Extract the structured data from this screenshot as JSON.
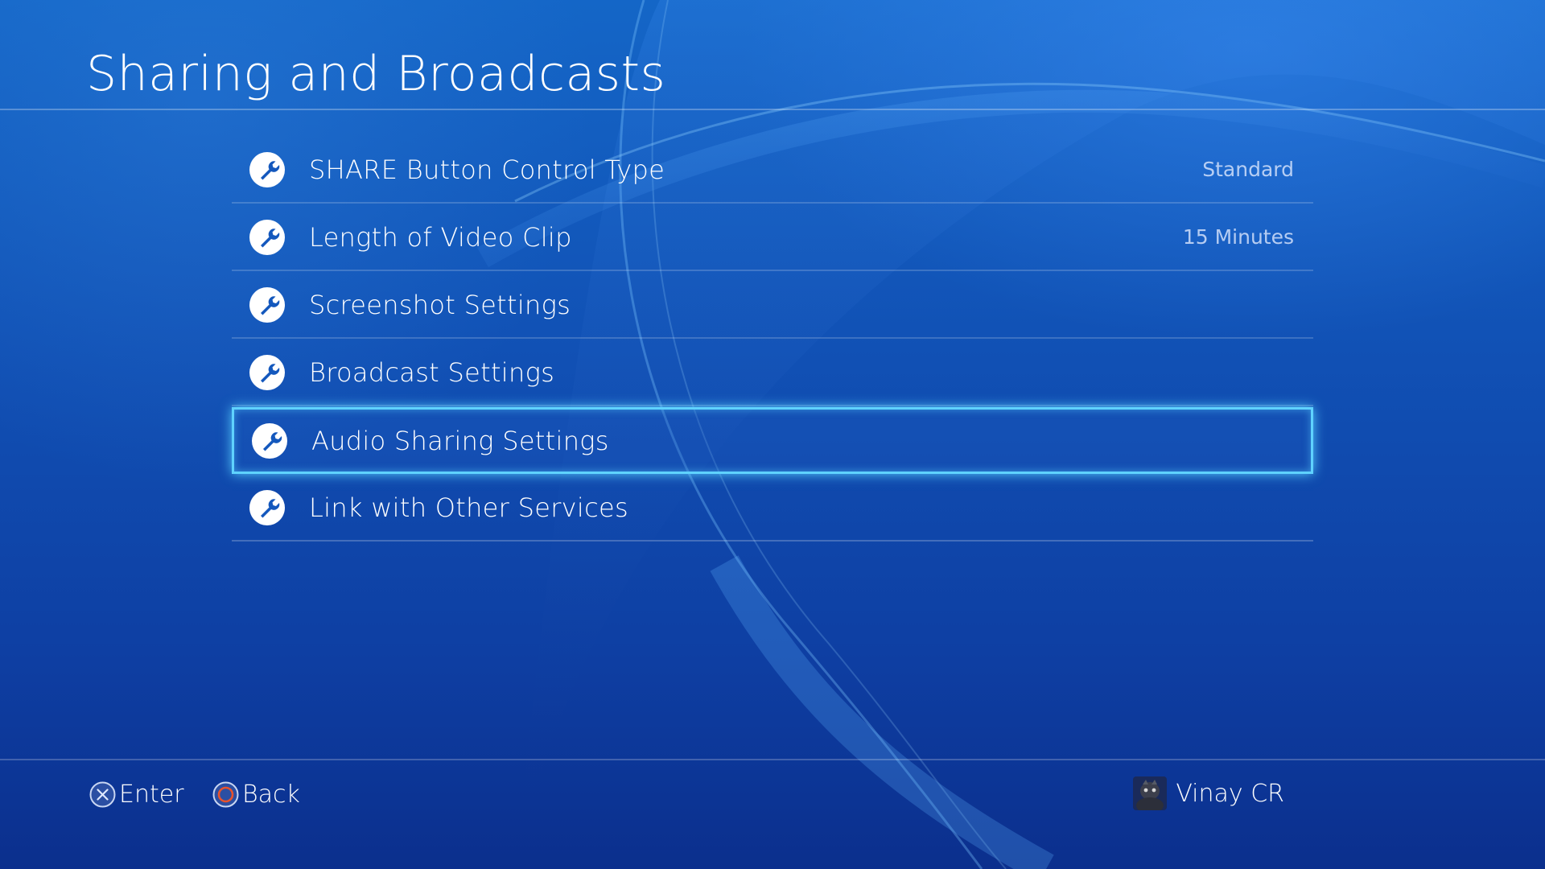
{
  "screen": {
    "title": "Sharing and Broadcasts"
  },
  "menu": {
    "items": [
      {
        "label": "SHARE Button Control Type",
        "value": "Standard",
        "icon": "wrench-icon",
        "selected": false
      },
      {
        "label": "Length of Video Clip",
        "value": "15 Minutes",
        "icon": "wrench-icon",
        "selected": false
      },
      {
        "label": "Screenshot Settings",
        "value": "",
        "icon": "wrench-icon",
        "selected": false
      },
      {
        "label": "Broadcast Settings",
        "value": "",
        "icon": "wrench-icon",
        "selected": false
      },
      {
        "label": "Audio Sharing Settings",
        "value": "",
        "icon": "wrench-icon",
        "selected": true
      },
      {
        "label": "Link with Other Services",
        "value": "",
        "icon": "wrench-icon",
        "selected": false
      }
    ]
  },
  "footer": {
    "enter_label": "Enter",
    "enter_icon": "cross-button-icon",
    "back_label": "Back",
    "back_icon": "circle-button-icon",
    "user_name": "Vinay CR",
    "user_icon": "avatar"
  },
  "colors": {
    "background_top": "#1466c7",
    "background_bottom": "#0b2f8d",
    "selection_border": "#5fd2ff",
    "circle_button": "#e8532d",
    "text": "#ffffff"
  }
}
